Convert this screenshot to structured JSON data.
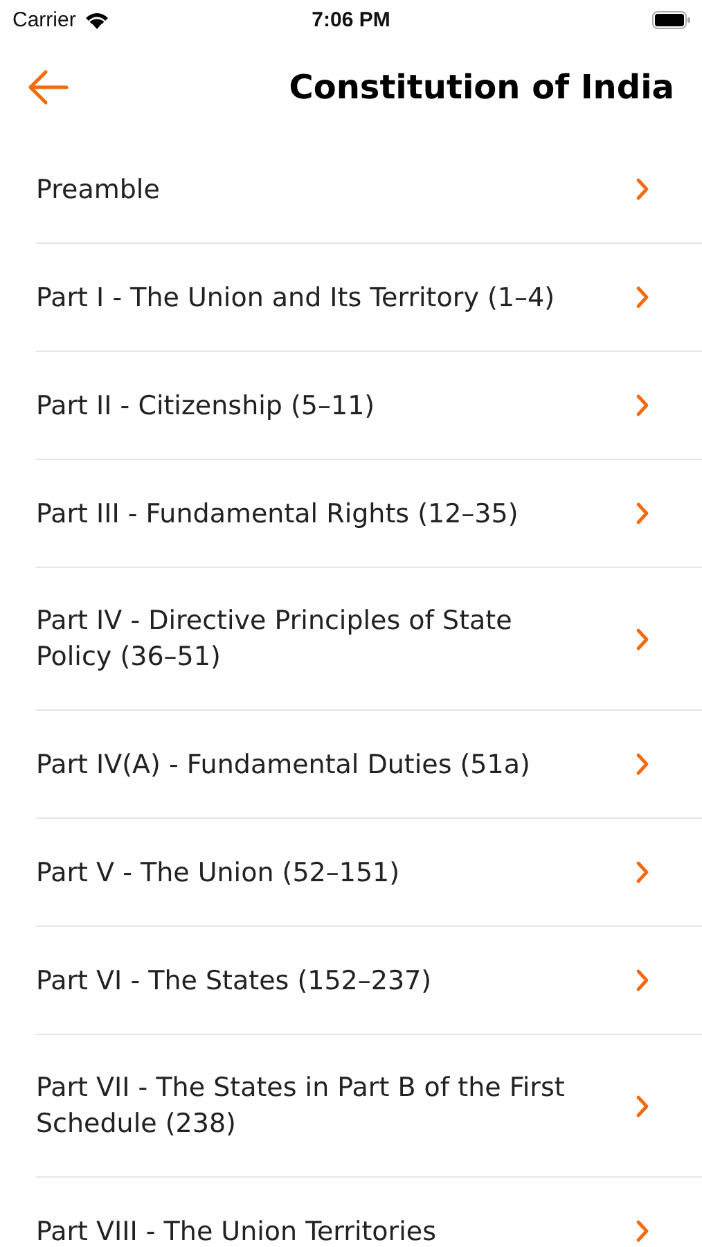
{
  "status_bar": {
    "carrier": "Carrier",
    "time": "7:06 PM"
  },
  "header": {
    "title": "Constitution of India"
  },
  "items": [
    {
      "label": "Preamble"
    },
    {
      "label": "Part I - The Union and Its Territory (1–4)"
    },
    {
      "label": "Part II - Citizenship (5–11)"
    },
    {
      "label": "Part III - Fundamental Rights (12–35)"
    },
    {
      "label": "Part IV - Directive Principles of State Policy (36–51)"
    },
    {
      "label": "Part IV(A) - Fundamental Duties (51a)"
    },
    {
      "label": "Part V - The Union (52–151)"
    },
    {
      "label": "Part VI - The States (152–237)"
    },
    {
      "label": "Part VII - The States in Part B of the First Schedule (238)"
    },
    {
      "label": "Part VIII - The Union Territories"
    }
  ]
}
